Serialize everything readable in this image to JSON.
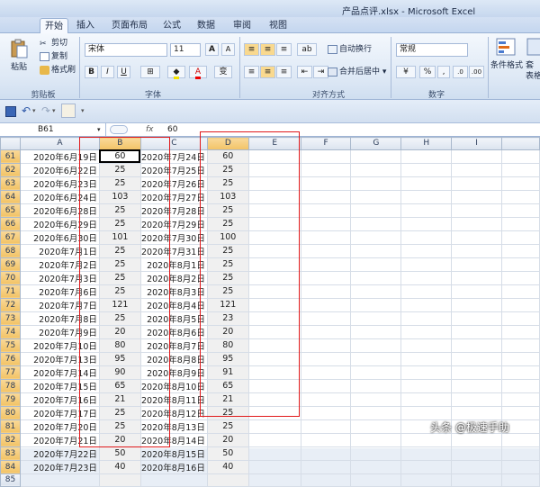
{
  "title": "产品点评.xlsx - Microsoft Excel",
  "tabs": [
    "开始",
    "插入",
    "页面布局",
    "公式",
    "数据",
    "审阅",
    "视图"
  ],
  "active_tab": "开始",
  "ribbon": {
    "clipboard": {
      "paste": "粘贴",
      "cut": "剪切",
      "copy": "复制",
      "format_painter": "格式刷",
      "label": "剪贴板"
    },
    "font": {
      "name": "宋体",
      "size": "11",
      "grow": "A",
      "shrink": "A",
      "bold": "B",
      "italic": "I",
      "underline": "U",
      "wen": "变",
      "label": "字体"
    },
    "alignment": {
      "wrap": "自动换行",
      "merge": "合并后居中",
      "label": "对齐方式"
    },
    "number": {
      "format": "常规",
      "percent": "%",
      "comma": ",",
      "label": "数字"
    },
    "styles": {
      "conditional": "条件格式",
      "table": "套",
      "table2": "表格"
    }
  },
  "formula_bar": {
    "name_box": "B61",
    "fx": "fx",
    "value": "60"
  },
  "columns": [
    "A",
    "B",
    "C",
    "D",
    "E",
    "F",
    "G",
    "H",
    "I"
  ],
  "selected_columns": [
    "B",
    "D"
  ],
  "rows": [
    {
      "n": "61",
      "a": "2020年6月19日",
      "b": "60",
      "c": "2020年7月24日",
      "d": "60"
    },
    {
      "n": "62",
      "a": "2020年6月22日",
      "b": "25",
      "c": "2020年7月25日",
      "d": "25"
    },
    {
      "n": "63",
      "a": "2020年6月23日",
      "b": "25",
      "c": "2020年7月26日",
      "d": "25"
    },
    {
      "n": "64",
      "a": "2020年6月24日",
      "b": "103",
      "c": "2020年7月27日",
      "d": "103"
    },
    {
      "n": "65",
      "a": "2020年6月28日",
      "b": "25",
      "c": "2020年7月28日",
      "d": "25"
    },
    {
      "n": "66",
      "a": "2020年6月29日",
      "b": "25",
      "c": "2020年7月29日",
      "d": "25"
    },
    {
      "n": "67",
      "a": "2020年6月30日",
      "b": "101",
      "c": "2020年7月30日",
      "d": "100"
    },
    {
      "n": "68",
      "a": "2020年7月1日",
      "b": "25",
      "c": "2020年7月31日",
      "d": "25"
    },
    {
      "n": "69",
      "a": "2020年7月2日",
      "b": "25",
      "c": "2020年8月1日",
      "d": "25"
    },
    {
      "n": "70",
      "a": "2020年7月3日",
      "b": "25",
      "c": "2020年8月2日",
      "d": "25"
    },
    {
      "n": "71",
      "a": "2020年7月6日",
      "b": "25",
      "c": "2020年8月3日",
      "d": "25"
    },
    {
      "n": "72",
      "a": "2020年7月7日",
      "b": "121",
      "c": "2020年8月4日",
      "d": "121"
    },
    {
      "n": "73",
      "a": "2020年7月8日",
      "b": "25",
      "c": "2020年8月5日",
      "d": "23"
    },
    {
      "n": "74",
      "a": "2020年7月9日",
      "b": "20",
      "c": "2020年8月6日",
      "d": "20"
    },
    {
      "n": "75",
      "a": "2020年7月10日",
      "b": "80",
      "c": "2020年8月7日",
      "d": "80"
    },
    {
      "n": "76",
      "a": "2020年7月13日",
      "b": "95",
      "c": "2020年8月8日",
      "d": "95"
    },
    {
      "n": "77",
      "a": "2020年7月14日",
      "b": "90",
      "c": "2020年8月9日",
      "d": "91"
    },
    {
      "n": "78",
      "a": "2020年7月15日",
      "b": "65",
      "c": "2020年8月10日",
      "d": "65"
    },
    {
      "n": "79",
      "a": "2020年7月16日",
      "b": "21",
      "c": "2020年8月11日",
      "d": "21"
    },
    {
      "n": "80",
      "a": "2020年7月17日",
      "b": "25",
      "c": "2020年8月12日",
      "d": "25"
    },
    {
      "n": "81",
      "a": "2020年7月20日",
      "b": "25",
      "c": "2020年8月13日",
      "d": "25"
    },
    {
      "n": "82",
      "a": "2020年7月21日",
      "b": "20",
      "c": "2020年8月14日",
      "d": "20"
    },
    {
      "n": "83",
      "a": "2020年7月22日",
      "b": "50",
      "c": "2020年8月15日",
      "d": "50"
    },
    {
      "n": "84",
      "a": "2020年7月23日",
      "b": "40",
      "c": "2020年8月16日",
      "d": "40"
    },
    {
      "n": "85",
      "a": "",
      "b": "",
      "c": "",
      "d": ""
    }
  ],
  "watermark": "头条 @极速手助",
  "colors": {
    "highlight_box": "#e0191b",
    "selected_header": "#f2c366"
  }
}
